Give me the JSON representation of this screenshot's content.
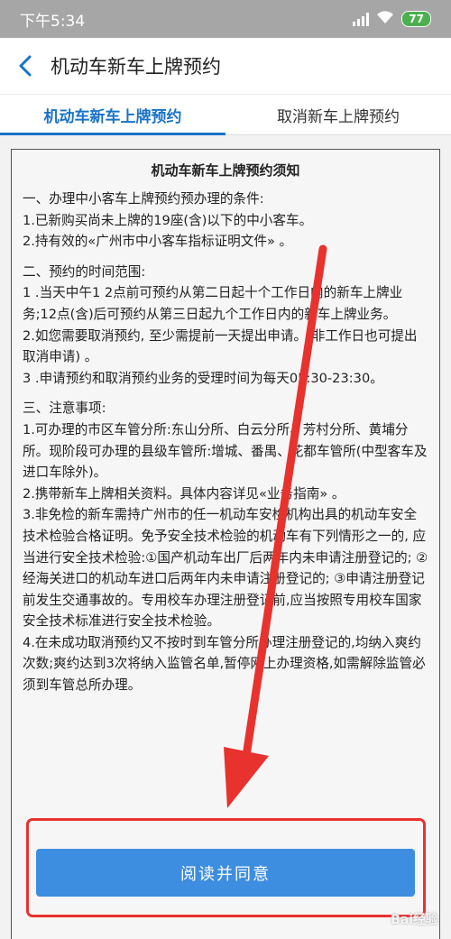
{
  "status": {
    "time": "下午5:34",
    "battery": "77",
    "signal_icon": "signal-icon",
    "wifi_icon": "wifi-icon"
  },
  "header": {
    "title": "机动车新车上牌预约",
    "back_icon": "back-arrow-icon"
  },
  "tabs": [
    {
      "label": "机动车新车上牌预约",
      "active": true
    },
    {
      "label": "取消新车上牌预约",
      "active": false
    }
  ],
  "notice": {
    "title": "机动车新车上牌预约须知",
    "sections": [
      {
        "lines": [
          "一、办理中小客车上牌预约预办理的条件:",
          "1.已新购买尚未上牌的19座(含)以下的中小客车。",
          "2.持有效的«广州市中小客车指标证明文件» 。"
        ]
      },
      {
        "lines": [
          "二、预约的时间范围:",
          "1 .当天中午1 2点前可预约从第二日起十个工作日内的新车上牌业务;12点(含)后可预约从第三日起九个工作日内的新车上牌业务。",
          "2.如您需要取消预约, 至少需提前一天提出申请。(非工作日也可提出取消申请) 。",
          "3 .申请预约和取消预约业务的受理时间为每天05:30-23:30。"
        ]
      },
      {
        "lines": [
          "三、注意事项:",
          "1.可办理的市区车管分所:东山分所、白云分所、芳村分所、黄埔分所。现阶段可办理的县级车管所:增城、番禺、花都车管所(中型客车及进口车除外)。",
          "2.携带新车上牌相关资料。具体内容详见«业务指南» 。",
          "3.非免检的新车需持广州市的任一机动车安检机构出具的机动车安全技术检验合格证明。免予安全技术检验的机动车有下列情形之一的, 应当进行安全技术检验:①国产机动车出厂后两年内未申请注册登记的; ②经海关进口的机动车进口后两年内未申请注册登记的; ③申请注册登记前发生交通事故的。专用校车办理注册登记前,应当按照专用校车国家安全技术标准进行安全技术检验。",
          "4.在未成功取消预约又不按时到车管分所办理注册登记的,均纳入爽约次数;爽约达到3次将纳入监管名单,暂停网上办理资格,如需解除监管必须到车管总所办理。"
        ]
      }
    ]
  },
  "agree_button": "阅读并同意",
  "annotation_color": "#e8322e",
  "accent_color": "#1a73c8",
  "watermark": "Bai经验"
}
